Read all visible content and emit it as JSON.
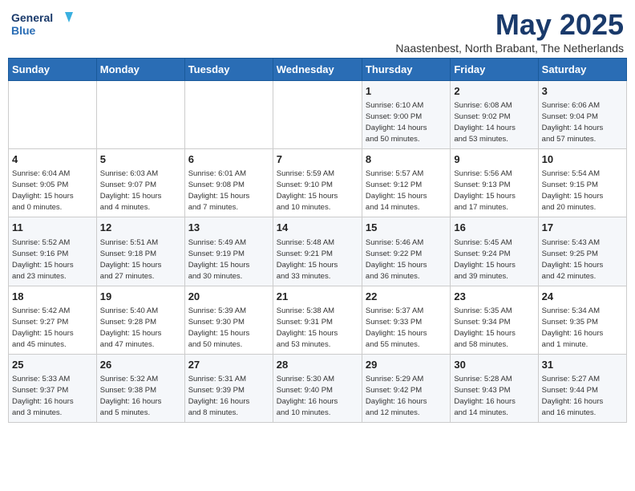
{
  "logo": {
    "line1": "General",
    "line2": "Blue"
  },
  "title": "May 2025",
  "subtitle": "Naastenbest, North Brabant, The Netherlands",
  "weekdays": [
    "Sunday",
    "Monday",
    "Tuesday",
    "Wednesday",
    "Thursday",
    "Friday",
    "Saturday"
  ],
  "weeks": [
    [
      {
        "day": "",
        "info": ""
      },
      {
        "day": "",
        "info": ""
      },
      {
        "day": "",
        "info": ""
      },
      {
        "day": "",
        "info": ""
      },
      {
        "day": "1",
        "info": "Sunrise: 6:10 AM\nSunset: 9:00 PM\nDaylight: 14 hours\nand 50 minutes."
      },
      {
        "day": "2",
        "info": "Sunrise: 6:08 AM\nSunset: 9:02 PM\nDaylight: 14 hours\nand 53 minutes."
      },
      {
        "day": "3",
        "info": "Sunrise: 6:06 AM\nSunset: 9:04 PM\nDaylight: 14 hours\nand 57 minutes."
      }
    ],
    [
      {
        "day": "4",
        "info": "Sunrise: 6:04 AM\nSunset: 9:05 PM\nDaylight: 15 hours\nand 0 minutes."
      },
      {
        "day": "5",
        "info": "Sunrise: 6:03 AM\nSunset: 9:07 PM\nDaylight: 15 hours\nand 4 minutes."
      },
      {
        "day": "6",
        "info": "Sunrise: 6:01 AM\nSunset: 9:08 PM\nDaylight: 15 hours\nand 7 minutes."
      },
      {
        "day": "7",
        "info": "Sunrise: 5:59 AM\nSunset: 9:10 PM\nDaylight: 15 hours\nand 10 minutes."
      },
      {
        "day": "8",
        "info": "Sunrise: 5:57 AM\nSunset: 9:12 PM\nDaylight: 15 hours\nand 14 minutes."
      },
      {
        "day": "9",
        "info": "Sunrise: 5:56 AM\nSunset: 9:13 PM\nDaylight: 15 hours\nand 17 minutes."
      },
      {
        "day": "10",
        "info": "Sunrise: 5:54 AM\nSunset: 9:15 PM\nDaylight: 15 hours\nand 20 minutes."
      }
    ],
    [
      {
        "day": "11",
        "info": "Sunrise: 5:52 AM\nSunset: 9:16 PM\nDaylight: 15 hours\nand 23 minutes."
      },
      {
        "day": "12",
        "info": "Sunrise: 5:51 AM\nSunset: 9:18 PM\nDaylight: 15 hours\nand 27 minutes."
      },
      {
        "day": "13",
        "info": "Sunrise: 5:49 AM\nSunset: 9:19 PM\nDaylight: 15 hours\nand 30 minutes."
      },
      {
        "day": "14",
        "info": "Sunrise: 5:48 AM\nSunset: 9:21 PM\nDaylight: 15 hours\nand 33 minutes."
      },
      {
        "day": "15",
        "info": "Sunrise: 5:46 AM\nSunset: 9:22 PM\nDaylight: 15 hours\nand 36 minutes."
      },
      {
        "day": "16",
        "info": "Sunrise: 5:45 AM\nSunset: 9:24 PM\nDaylight: 15 hours\nand 39 minutes."
      },
      {
        "day": "17",
        "info": "Sunrise: 5:43 AM\nSunset: 9:25 PM\nDaylight: 15 hours\nand 42 minutes."
      }
    ],
    [
      {
        "day": "18",
        "info": "Sunrise: 5:42 AM\nSunset: 9:27 PM\nDaylight: 15 hours\nand 45 minutes."
      },
      {
        "day": "19",
        "info": "Sunrise: 5:40 AM\nSunset: 9:28 PM\nDaylight: 15 hours\nand 47 minutes."
      },
      {
        "day": "20",
        "info": "Sunrise: 5:39 AM\nSunset: 9:30 PM\nDaylight: 15 hours\nand 50 minutes."
      },
      {
        "day": "21",
        "info": "Sunrise: 5:38 AM\nSunset: 9:31 PM\nDaylight: 15 hours\nand 53 minutes."
      },
      {
        "day": "22",
        "info": "Sunrise: 5:37 AM\nSunset: 9:33 PM\nDaylight: 15 hours\nand 55 minutes."
      },
      {
        "day": "23",
        "info": "Sunrise: 5:35 AM\nSunset: 9:34 PM\nDaylight: 15 hours\nand 58 minutes."
      },
      {
        "day": "24",
        "info": "Sunrise: 5:34 AM\nSunset: 9:35 PM\nDaylight: 16 hours\nand 1 minute."
      }
    ],
    [
      {
        "day": "25",
        "info": "Sunrise: 5:33 AM\nSunset: 9:37 PM\nDaylight: 16 hours\nand 3 minutes."
      },
      {
        "day": "26",
        "info": "Sunrise: 5:32 AM\nSunset: 9:38 PM\nDaylight: 16 hours\nand 5 minutes."
      },
      {
        "day": "27",
        "info": "Sunrise: 5:31 AM\nSunset: 9:39 PM\nDaylight: 16 hours\nand 8 minutes."
      },
      {
        "day": "28",
        "info": "Sunrise: 5:30 AM\nSunset: 9:40 PM\nDaylight: 16 hours\nand 10 minutes."
      },
      {
        "day": "29",
        "info": "Sunrise: 5:29 AM\nSunset: 9:42 PM\nDaylight: 16 hours\nand 12 minutes."
      },
      {
        "day": "30",
        "info": "Sunrise: 5:28 AM\nSunset: 9:43 PM\nDaylight: 16 hours\nand 14 minutes."
      },
      {
        "day": "31",
        "info": "Sunrise: 5:27 AM\nSunset: 9:44 PM\nDaylight: 16 hours\nand 16 minutes."
      }
    ]
  ]
}
